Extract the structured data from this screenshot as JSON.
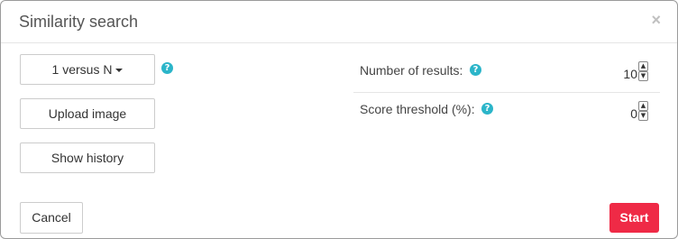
{
  "dialog": {
    "title": "Similarity search",
    "close_glyph": "×"
  },
  "left": {
    "mode_dropdown": {
      "selected": "1 versus N",
      "icon": "caret-down-icon"
    },
    "help_glyph": "?",
    "upload_label": "Upload image",
    "history_label": "Show history"
  },
  "settings": {
    "results": {
      "label": "Number of results:",
      "value": "10"
    },
    "threshold": {
      "label": "Score threshold (%):",
      "value": "0"
    }
  },
  "footer": {
    "cancel_label": "Cancel",
    "start_label": "Start"
  },
  "colors": {
    "accent_help": "#2bb5c9",
    "start_button": "#ef2a46"
  }
}
